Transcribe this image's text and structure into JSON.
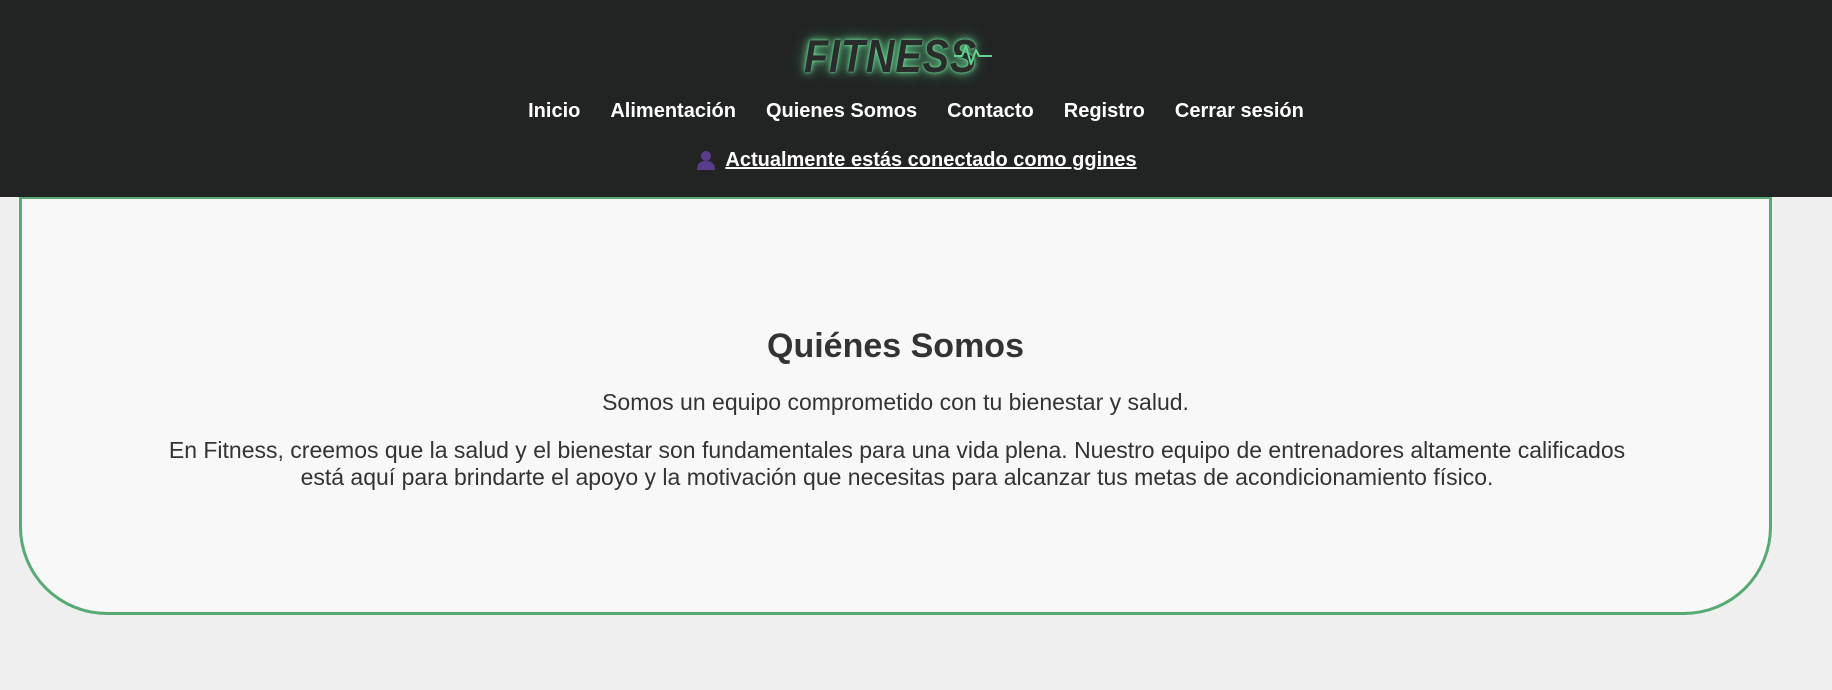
{
  "header": {
    "logo_text": "FITNESS",
    "nav": [
      {
        "label": "Inicio"
      },
      {
        "label": "Alimentación"
      },
      {
        "label": "Quienes Somos"
      },
      {
        "label": "Contacto"
      },
      {
        "label": "Registro"
      },
      {
        "label": "Cerrar sesión"
      }
    ],
    "user_status": {
      "icon": "user-icon",
      "text": "Actualmente estás conectado como ggines"
    }
  },
  "main": {
    "title": "Quiénes Somos",
    "subtitle": "Somos un equipo comprometido con tu bienestar y salud.",
    "body": "En Fitness, creemos que la salud y el bienestar son fundamentales para una vida plena. Nuestro equipo de entrenadores altamente calificados está aquí para brindarte el apoyo y la motivación que necesitas para alcanzar tus metas de acondicionamiento físico."
  },
  "colors": {
    "header_bg": "#222424",
    "page_bg": "#efefef",
    "card_bg": "#f8f8f8",
    "accent_green": "#57aa74",
    "logo_glow": "#63d38f",
    "user_icon": "#5a3c8c",
    "text_dark": "#333333"
  }
}
